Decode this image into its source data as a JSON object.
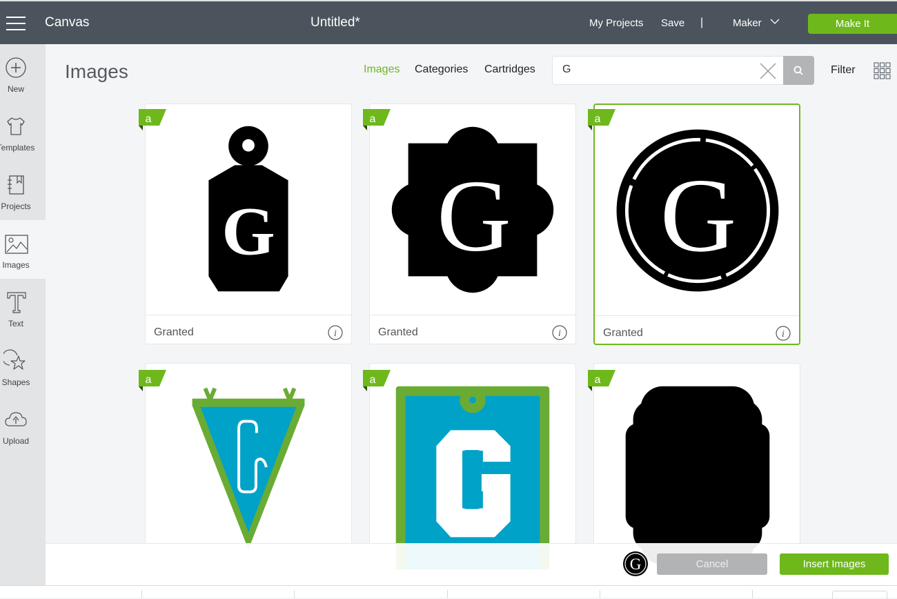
{
  "topbar": {
    "app_title": "Canvas",
    "doc_title": "Untitled*",
    "my_projects": "My Projects",
    "save": "Save",
    "separator": "|",
    "machine": "Maker",
    "make_it": "Make It",
    "accent_color": "#6eb81c",
    "bar_color": "#4b545c"
  },
  "sidebar": {
    "items": [
      {
        "label": "New",
        "icon": "plus-circle-icon"
      },
      {
        "label": "Templates",
        "icon": "tshirt-icon"
      },
      {
        "label": "Projects",
        "icon": "notebook-icon"
      },
      {
        "label": "Images",
        "icon": "image-icon",
        "active": true
      },
      {
        "label": "Text",
        "icon": "text-t-icon"
      },
      {
        "label": "Shapes",
        "icon": "shapes-icon"
      },
      {
        "label": "Upload",
        "icon": "cloud-upload-icon"
      }
    ]
  },
  "main": {
    "heading": "Images",
    "tabs": [
      {
        "label": "Images",
        "active": true
      },
      {
        "label": "Categories"
      },
      {
        "label": "Cartridges"
      }
    ],
    "search": {
      "value": "G",
      "placeholder": ""
    },
    "filter_label": "Filter"
  },
  "cards": [
    {
      "name": "Granted",
      "art": "tag-g",
      "badge": "a",
      "selected": false
    },
    {
      "name": "Granted",
      "art": "quatrefoil-g",
      "badge": "a",
      "selected": false
    },
    {
      "name": "Granted",
      "art": "circle-seal-g",
      "badge": "a",
      "selected": true
    },
    {
      "name": "",
      "art": "pennant-g",
      "badge": "a",
      "selected": false
    },
    {
      "name": "",
      "art": "varsity-tag-g",
      "badge": "a",
      "selected": false
    },
    {
      "name": "",
      "art": "scalloped-square",
      "badge": "a",
      "selected": false
    }
  ],
  "footer": {
    "selected_thumb": "G",
    "cancel": "Cancel",
    "insert": "Insert Images"
  }
}
